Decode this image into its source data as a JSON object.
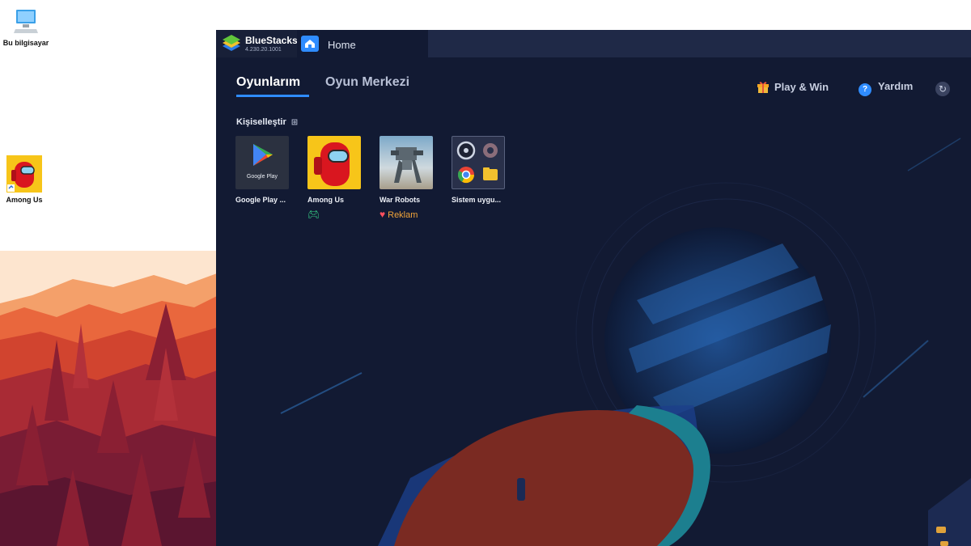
{
  "desktop": {
    "icons": [
      {
        "label": "Bu bilgisayar",
        "icon": "computer-icon"
      },
      {
        "label": "Among Us",
        "icon": "among-us-icon"
      }
    ]
  },
  "bluestacks": {
    "app_name": "BlueStacks",
    "version": "4.230.20.1001",
    "tab_label": "Home",
    "tabs": [
      {
        "label": "Oyunlarım",
        "active": true
      },
      {
        "label": "Oyun Merkezi",
        "active": false
      }
    ],
    "actions": {
      "play_win": "Play & Win",
      "help": "Yardım"
    },
    "personalize_label": "Kişiselleştir",
    "apps": [
      {
        "name": "Google Play ...",
        "thumb_text": "Google Play",
        "icon": "google-play-icon"
      },
      {
        "name": "Among Us",
        "icon": "among-us-icon",
        "badge_icon": "gamepad-icon"
      },
      {
        "name": "War Robots",
        "icon": "war-robots-icon",
        "badge_icon": "heart-icon",
        "badge_text": "Reklam"
      },
      {
        "name": "Sistem uygu...",
        "icon": "system-apps-icon"
      }
    ],
    "colors": {
      "background": "#121a33",
      "titlebar": "#1f2947",
      "accent": "#2f8cff",
      "ad_text": "#f0a43a"
    }
  }
}
